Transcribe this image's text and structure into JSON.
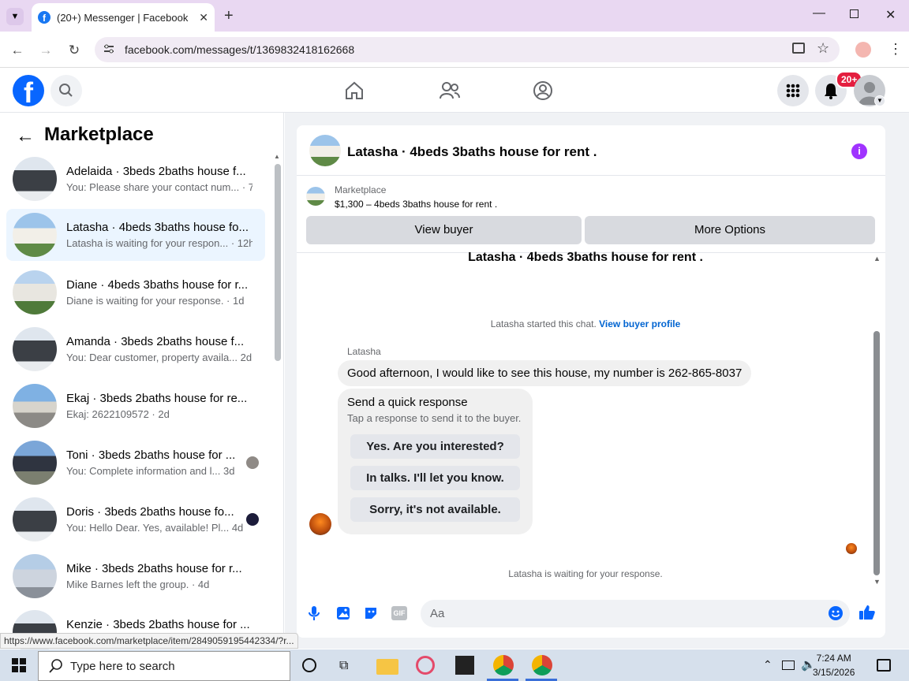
{
  "browser": {
    "tab_title": "(20+) Messenger | Facebook",
    "url": "facebook.com/messages/t/1369832418162668",
    "status_url": "https://www.facebook.com/marketplace/item/2849059195442334/?r..."
  },
  "header": {
    "notification_badge": "20+"
  },
  "left": {
    "title": "Marketplace",
    "conversations": [
      {
        "name": "Adelaida · 3beds 2baths house f...",
        "sub": "You: Please share your contact num... · 7h"
      },
      {
        "name": "Latasha · 4beds 3baths house fo...",
        "sub": "Latasha is waiting for your respon... · 12h"
      },
      {
        "name": "Diane · 4beds 3baths house for r...",
        "sub": "Diane is waiting for your response. · 1d"
      },
      {
        "name": "Amanda · 3beds 2baths house f...",
        "sub": "You: Dear customer, property availa... 2d"
      },
      {
        "name": "Ekaj · 3beds 2baths house for re...",
        "sub": "Ekaj: 2622109572 · 2d"
      },
      {
        "name": "Toni · 3beds 2baths house for ...",
        "sub": "You: Complete information and l... 3d"
      },
      {
        "name": "Doris · 3beds 2baths house fo...",
        "sub": "You: Hello Dear. Yes, available! Pl... 4d"
      },
      {
        "name": "Mike · 3beds 2baths house for r...",
        "sub": "Mike Barnes left the group. · 4d"
      },
      {
        "name": "Kenzie · 3beds 2baths house for ...",
        "sub": ""
      }
    ]
  },
  "chat": {
    "title": "Latasha · 4beds 3baths house for rent .",
    "listing_label": "Marketplace",
    "listing_price": "$1,300 – 4beds 3baths house for rent .",
    "view_buyer": "View buyer",
    "more_options": "More Options",
    "heading": "Latasha · 4beds 3baths house for rent .",
    "started_text": "Latasha started this chat.",
    "view_profile": "View buyer profile",
    "sender": "Latasha",
    "message": "Good afternoon, I would like to see this house, my number is 262-865-8037",
    "quick_title": "Send a quick response",
    "quick_sub": "Tap a response to send it to the buyer.",
    "quick_replies": [
      "Yes. Are you interested?",
      "In talks. I'll let you know.",
      "Sorry, it's not available."
    ],
    "waiting": "Latasha is waiting for your response.",
    "composer_placeholder": "Aa"
  },
  "taskbar": {
    "search_placeholder": "Type here to search",
    "time": "7:24 AM",
    "date": "3/15/2026"
  }
}
